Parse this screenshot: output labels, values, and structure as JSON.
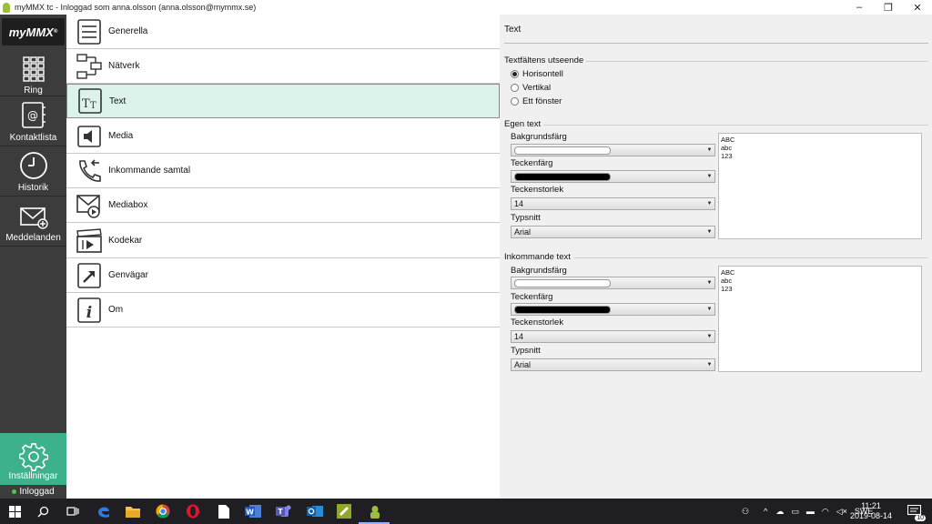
{
  "window": {
    "title": "myMMX tc - Inloggad som anna.olsson (anna.olsson@mymmx.se)",
    "minimize": "–",
    "restore": "❐",
    "close": "✕"
  },
  "sidebar": {
    "logo": "myMMX",
    "items": [
      {
        "label": "Ring",
        "icon": "dialpad-icon"
      },
      {
        "label": "Kontaktlista",
        "icon": "contacts-icon"
      },
      {
        "label": "Historik",
        "icon": "clock-icon"
      },
      {
        "label": "Meddelanden",
        "icon": "mail-icon"
      }
    ],
    "settings_label": "Inställningar",
    "status_label": "Inloggad",
    "accent": "#3db08c"
  },
  "settings_list": {
    "items": [
      {
        "label": "Generella",
        "icon": "list-icon"
      },
      {
        "label": "Nätverk",
        "icon": "network-icon"
      },
      {
        "label": "Text",
        "icon": "text-icon",
        "selected": true
      },
      {
        "label": "Media",
        "icon": "speaker-icon"
      },
      {
        "label": "Inkommande samtal",
        "icon": "incoming-call-icon"
      },
      {
        "label": "Mediabox",
        "icon": "mediabox-icon"
      },
      {
        "label": "Kodekar",
        "icon": "codec-icon"
      },
      {
        "label": "Genvägar",
        "icon": "shortcut-icon"
      },
      {
        "label": "Om",
        "icon": "info-icon"
      }
    ]
  },
  "panel": {
    "title": "Text",
    "appearance": {
      "label": "Textfältens utseende",
      "options": [
        "Horisontell",
        "Vertikal",
        "Ett fönster"
      ],
      "selected": "Horisontell"
    },
    "own_text": {
      "label": "Egen text",
      "background_label": "Bakgrundsfärg",
      "background_color": "#ffffff",
      "font_color_label": "Teckenfärg",
      "font_color": "#000000",
      "font_size_label": "Teckenstorlek",
      "font_size": "14",
      "font_label": "Typsnitt",
      "font": "Arial",
      "preview": [
        "ABC",
        "abc",
        "123"
      ]
    },
    "incoming_text": {
      "label": "Inkommande text",
      "background_label": "Bakgrundsfärg",
      "background_color": "#ffffff",
      "font_color_label": "Teckenfärg",
      "font_color": "#000000",
      "font_size_label": "Teckenstorlek",
      "font_size": "14",
      "font_label": "Typsnitt",
      "font": "Arial",
      "preview": [
        "ABC",
        "abc",
        "123"
      ]
    }
  },
  "taskbar": {
    "language": "SWE",
    "time": "11:21",
    "date": "2019-08-14",
    "notification_count": "10"
  }
}
